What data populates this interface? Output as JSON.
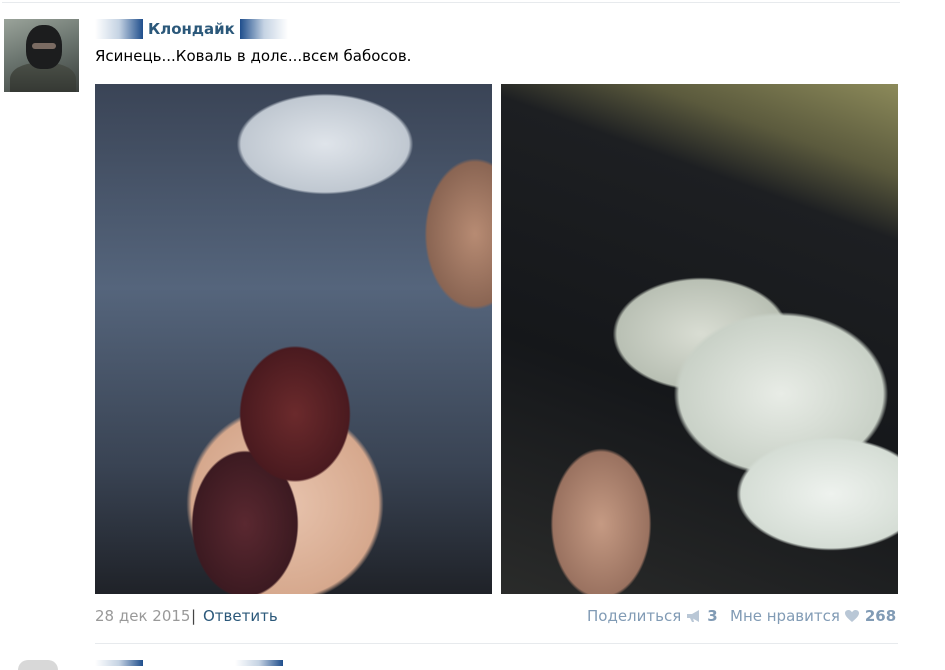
{
  "post": {
    "author": "Клондайк",
    "text": "Ясинець...Коваль в долє...всєм бабосов.",
    "date": "28 дек 2015",
    "separator": "|",
    "reply_label": "Ответить",
    "share_label": "Поделиться",
    "share_count": "3",
    "like_label": "Мне нравится",
    "like_count": "268",
    "photos": [
      {
        "icon": "photo-amber"
      },
      {
        "icon": "photo-dollars"
      }
    ]
  },
  "colors": {
    "link": "#2b587a",
    "muted": "#999999",
    "action": "#819bb5"
  }
}
